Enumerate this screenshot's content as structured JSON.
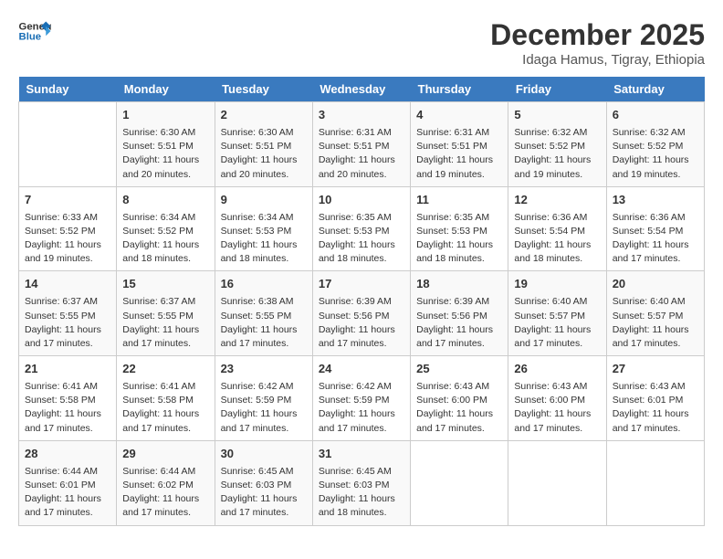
{
  "header": {
    "logo_line1": "General",
    "logo_line2": "Blue",
    "title": "December 2025",
    "subtitle": "Idaga Hamus, Tigray, Ethiopia"
  },
  "calendar": {
    "days_of_week": [
      "Sunday",
      "Monday",
      "Tuesday",
      "Wednesday",
      "Thursday",
      "Friday",
      "Saturday"
    ],
    "weeks": [
      [
        {
          "day": "",
          "info": ""
        },
        {
          "day": "1",
          "info": "Sunrise: 6:30 AM\nSunset: 5:51 PM\nDaylight: 11 hours and 20 minutes."
        },
        {
          "day": "2",
          "info": "Sunrise: 6:30 AM\nSunset: 5:51 PM\nDaylight: 11 hours and 20 minutes."
        },
        {
          "day": "3",
          "info": "Sunrise: 6:31 AM\nSunset: 5:51 PM\nDaylight: 11 hours and 20 minutes."
        },
        {
          "day": "4",
          "info": "Sunrise: 6:31 AM\nSunset: 5:51 PM\nDaylight: 11 hours and 19 minutes."
        },
        {
          "day": "5",
          "info": "Sunrise: 6:32 AM\nSunset: 5:52 PM\nDaylight: 11 hours and 19 minutes."
        },
        {
          "day": "6",
          "info": "Sunrise: 6:32 AM\nSunset: 5:52 PM\nDaylight: 11 hours and 19 minutes."
        }
      ],
      [
        {
          "day": "7",
          "info": "Sunrise: 6:33 AM\nSunset: 5:52 PM\nDaylight: 11 hours and 19 minutes."
        },
        {
          "day": "8",
          "info": "Sunrise: 6:34 AM\nSunset: 5:52 PM\nDaylight: 11 hours and 18 minutes."
        },
        {
          "day": "9",
          "info": "Sunrise: 6:34 AM\nSunset: 5:53 PM\nDaylight: 11 hours and 18 minutes."
        },
        {
          "day": "10",
          "info": "Sunrise: 6:35 AM\nSunset: 5:53 PM\nDaylight: 11 hours and 18 minutes."
        },
        {
          "day": "11",
          "info": "Sunrise: 6:35 AM\nSunset: 5:53 PM\nDaylight: 11 hours and 18 minutes."
        },
        {
          "day": "12",
          "info": "Sunrise: 6:36 AM\nSunset: 5:54 PM\nDaylight: 11 hours and 18 minutes."
        },
        {
          "day": "13",
          "info": "Sunrise: 6:36 AM\nSunset: 5:54 PM\nDaylight: 11 hours and 17 minutes."
        }
      ],
      [
        {
          "day": "14",
          "info": "Sunrise: 6:37 AM\nSunset: 5:55 PM\nDaylight: 11 hours and 17 minutes."
        },
        {
          "day": "15",
          "info": "Sunrise: 6:37 AM\nSunset: 5:55 PM\nDaylight: 11 hours and 17 minutes."
        },
        {
          "day": "16",
          "info": "Sunrise: 6:38 AM\nSunset: 5:55 PM\nDaylight: 11 hours and 17 minutes."
        },
        {
          "day": "17",
          "info": "Sunrise: 6:39 AM\nSunset: 5:56 PM\nDaylight: 11 hours and 17 minutes."
        },
        {
          "day": "18",
          "info": "Sunrise: 6:39 AM\nSunset: 5:56 PM\nDaylight: 11 hours and 17 minutes."
        },
        {
          "day": "19",
          "info": "Sunrise: 6:40 AM\nSunset: 5:57 PM\nDaylight: 11 hours and 17 minutes."
        },
        {
          "day": "20",
          "info": "Sunrise: 6:40 AM\nSunset: 5:57 PM\nDaylight: 11 hours and 17 minutes."
        }
      ],
      [
        {
          "day": "21",
          "info": "Sunrise: 6:41 AM\nSunset: 5:58 PM\nDaylight: 11 hours and 17 minutes."
        },
        {
          "day": "22",
          "info": "Sunrise: 6:41 AM\nSunset: 5:58 PM\nDaylight: 11 hours and 17 minutes."
        },
        {
          "day": "23",
          "info": "Sunrise: 6:42 AM\nSunset: 5:59 PM\nDaylight: 11 hours and 17 minutes."
        },
        {
          "day": "24",
          "info": "Sunrise: 6:42 AM\nSunset: 5:59 PM\nDaylight: 11 hours and 17 minutes."
        },
        {
          "day": "25",
          "info": "Sunrise: 6:43 AM\nSunset: 6:00 PM\nDaylight: 11 hours and 17 minutes."
        },
        {
          "day": "26",
          "info": "Sunrise: 6:43 AM\nSunset: 6:00 PM\nDaylight: 11 hours and 17 minutes."
        },
        {
          "day": "27",
          "info": "Sunrise: 6:43 AM\nSunset: 6:01 PM\nDaylight: 11 hours and 17 minutes."
        }
      ],
      [
        {
          "day": "28",
          "info": "Sunrise: 6:44 AM\nSunset: 6:01 PM\nDaylight: 11 hours and 17 minutes."
        },
        {
          "day": "29",
          "info": "Sunrise: 6:44 AM\nSunset: 6:02 PM\nDaylight: 11 hours and 17 minutes."
        },
        {
          "day": "30",
          "info": "Sunrise: 6:45 AM\nSunset: 6:03 PM\nDaylight: 11 hours and 17 minutes."
        },
        {
          "day": "31",
          "info": "Sunrise: 6:45 AM\nSunset: 6:03 PM\nDaylight: 11 hours and 18 minutes."
        },
        {
          "day": "",
          "info": ""
        },
        {
          "day": "",
          "info": ""
        },
        {
          "day": "",
          "info": ""
        }
      ]
    ]
  }
}
